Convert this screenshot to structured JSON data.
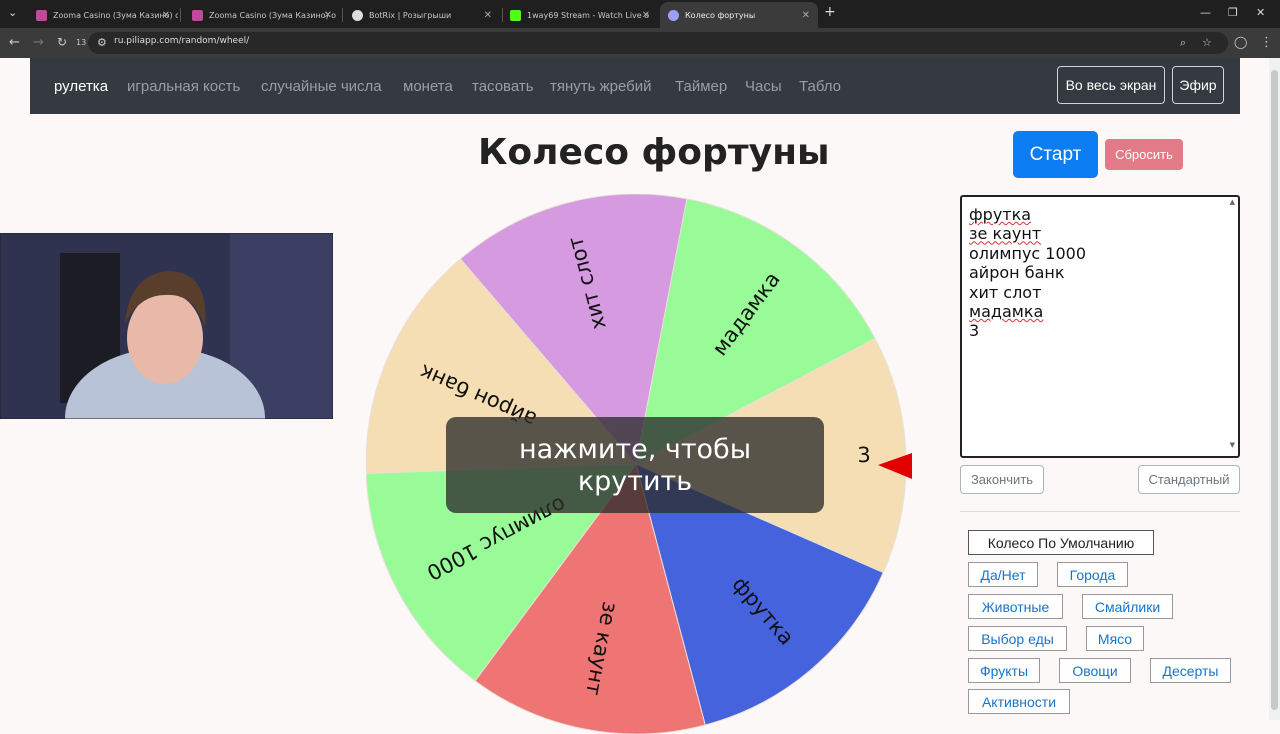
{
  "browser": {
    "tabs": [
      {
        "title": "Zooma Casino (Зума Казино) о",
        "favicon_color": "#c04a9a"
      },
      {
        "title": "Zooma Casino (Зума Казино) о",
        "favicon_color": "#c04a9a"
      },
      {
        "title": "BotRix | Розыгрыши",
        "favicon_color": "#dddddd"
      },
      {
        "title": "1way69 Stream - Watch Live o",
        "favicon_color": "#53fc18"
      },
      {
        "title": "Колесо фортуны",
        "favicon_color": "#9aa0ff"
      }
    ],
    "address": "ru.piliapp.com/random/wheel/",
    "tab_count_badge": "13"
  },
  "nav": {
    "links": [
      "рулетка",
      "игральная кость",
      "случайные числа",
      "монета",
      "тасовать",
      "тянуть жребий",
      "Таймер",
      "Часы",
      "Табло"
    ],
    "fullscreen_label": "Во весь экран",
    "live_label": "Эфир"
  },
  "page": {
    "title": "Колесо фортуны",
    "start_label": "Старт",
    "reset_label": "Сбросить",
    "overlay_text_1": "нажмите, чтобы",
    "overlay_text_2": "крутить",
    "finish_label": "Закончить",
    "default_label": "Стандартный"
  },
  "entries": [
    "фрутка",
    "зе каунт",
    "олимпус 1000",
    "айрон банк",
    "хит слот",
    "мадамка",
    "3"
  ],
  "presets": [
    "Колесо По Умолчанию",
    "Да/Нет",
    "Города",
    "Животные",
    "Смайлики",
    "Выбор еды",
    "Мясо",
    "Фрукты",
    "Овощи",
    "Десерты",
    "Активности"
  ],
  "wheel": {
    "segments": [
      {
        "label": "3",
        "color": "#f5deb3"
      },
      {
        "label": "фрутка",
        "color": "#4563dd"
      },
      {
        "label": "зе каунт",
        "color": "#ef7474"
      },
      {
        "label": "олимпус 1000",
        "color": "#98fb98"
      },
      {
        "label": "айрон банк",
        "color": "#f5deb3"
      },
      {
        "label": "хит слот",
        "color": "#d59adf"
      },
      {
        "label": "мадамка",
        "color": "#98fb98"
      }
    ],
    "pointer_color": "#e00000"
  }
}
